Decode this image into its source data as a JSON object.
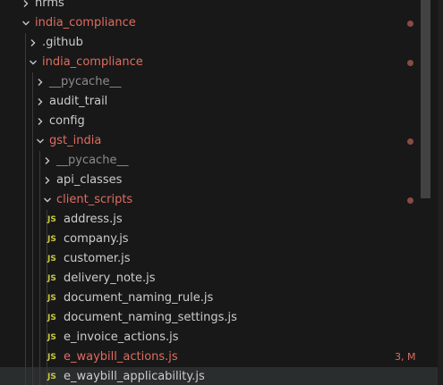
{
  "colors": {
    "background": "#181818",
    "text": "#cccccc",
    "modified_text": "#e06c60",
    "dim_text": "#8b8b8b",
    "js_icon": "#cbcb41",
    "modified_dot": "#8a4b42",
    "hover_row": "#2a2d2e"
  },
  "tree": [
    {
      "label": "hrms",
      "kind": "folder",
      "expanded": false,
      "status": "normal"
    },
    {
      "label": "india_compliance",
      "kind": "folder",
      "expanded": true,
      "status": "modified",
      "dot": true
    },
    {
      "label": ".github",
      "kind": "folder",
      "expanded": false,
      "status": "normal"
    },
    {
      "label": "india_compliance",
      "kind": "folder",
      "expanded": true,
      "status": "modified",
      "dot": true
    },
    {
      "label": "__pycache__",
      "kind": "folder",
      "expanded": false,
      "status": "dim"
    },
    {
      "label": "audit_trail",
      "kind": "folder",
      "expanded": false,
      "status": "normal"
    },
    {
      "label": "config",
      "kind": "folder",
      "expanded": false,
      "status": "normal"
    },
    {
      "label": "gst_india",
      "kind": "folder",
      "expanded": true,
      "status": "modified",
      "dot": true
    },
    {
      "label": "__pycache__",
      "kind": "folder",
      "expanded": false,
      "status": "dim"
    },
    {
      "label": "api_classes",
      "kind": "folder",
      "expanded": false,
      "status": "normal"
    },
    {
      "label": "client_scripts",
      "kind": "folder",
      "expanded": true,
      "status": "modified",
      "dot": true
    },
    {
      "label": "address.js",
      "kind": "file",
      "icon": "JS",
      "status": "normal"
    },
    {
      "label": "company.js",
      "kind": "file",
      "icon": "JS",
      "status": "normal"
    },
    {
      "label": "customer.js",
      "kind": "file",
      "icon": "JS",
      "status": "normal"
    },
    {
      "label": "delivery_note.js",
      "kind": "file",
      "icon": "JS",
      "status": "normal"
    },
    {
      "label": "document_naming_rule.js",
      "kind": "file",
      "icon": "JS",
      "status": "normal"
    },
    {
      "label": "document_naming_settings.js",
      "kind": "file",
      "icon": "JS",
      "status": "normal"
    },
    {
      "label": "e_invoice_actions.js",
      "kind": "file",
      "icon": "JS",
      "status": "normal"
    },
    {
      "label": "e_waybill_actions.js",
      "kind": "file",
      "icon": "JS",
      "status": "modified",
      "badge": "3, M"
    },
    {
      "label": "e_waybill_applicability.js",
      "kind": "file",
      "icon": "JS",
      "status": "normal",
      "hovered": true
    }
  ]
}
